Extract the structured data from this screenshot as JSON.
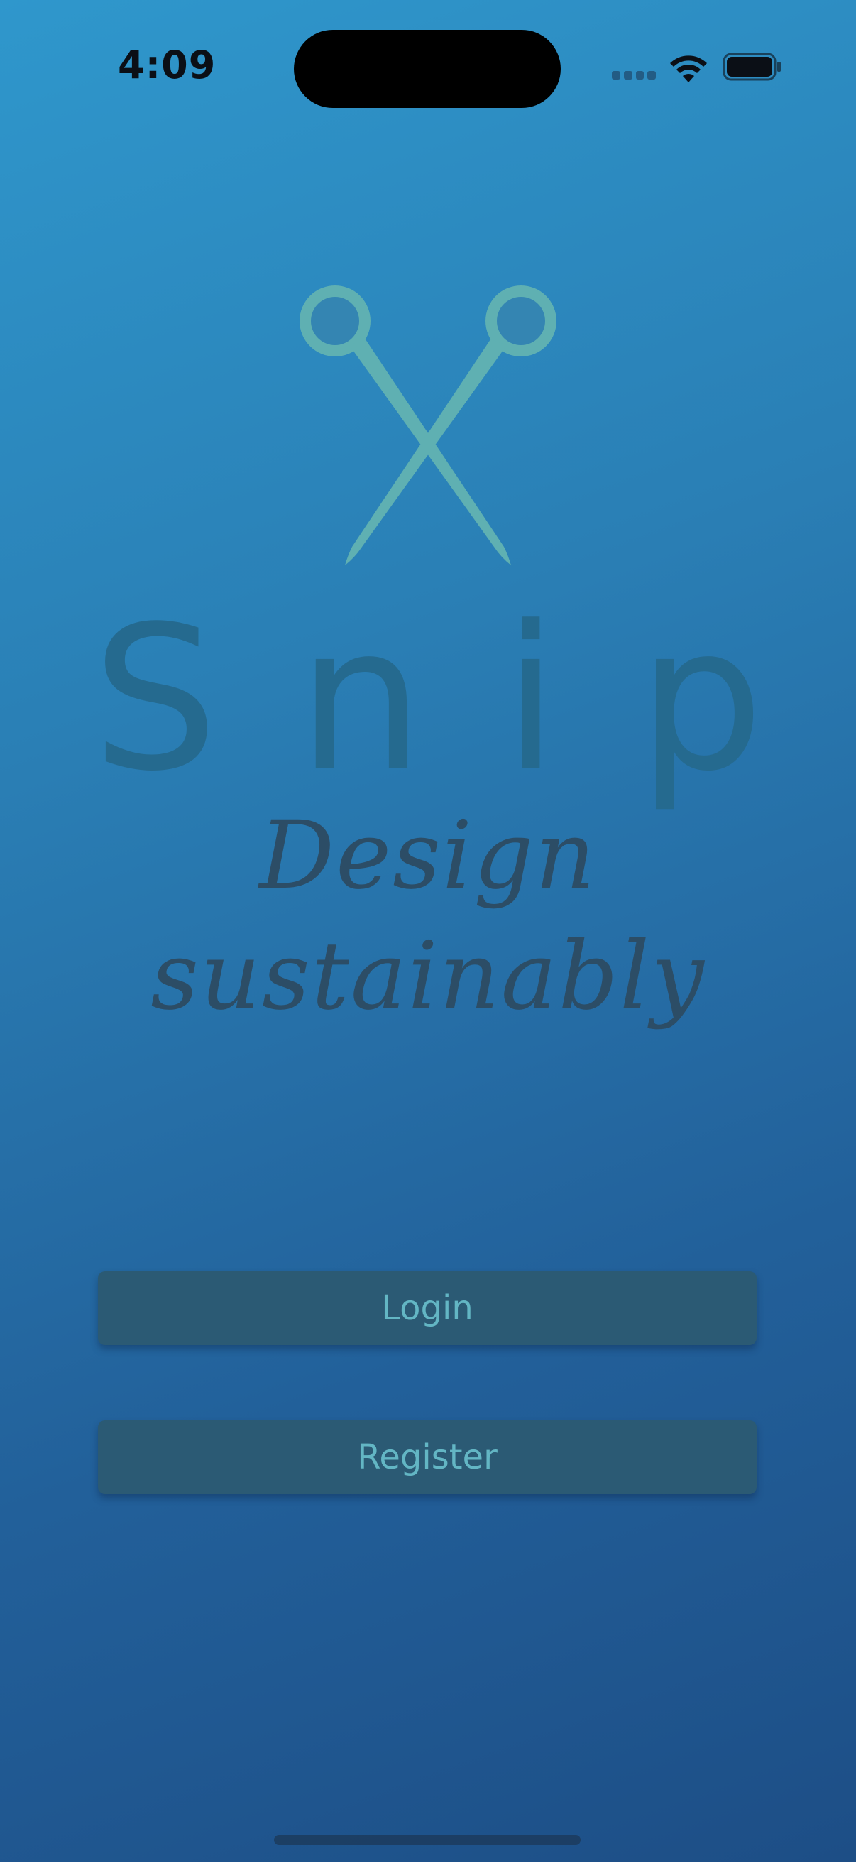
{
  "status_bar": {
    "time": "4:09",
    "icons": [
      "cellular-signal-icon",
      "wifi-icon",
      "battery-icon"
    ]
  },
  "branding": {
    "logo_icon": "scissors-icon",
    "app_name": "Snip",
    "tagline": "Design sustainably"
  },
  "actions": {
    "login_label": "Login",
    "register_label": "Register"
  },
  "colors": {
    "background_top": "#2f97cc",
    "background_bottom": "#1d4e86",
    "logo": "#5fb0b2",
    "button_background": "#2b5a74",
    "button_text": "#63b6c4"
  }
}
